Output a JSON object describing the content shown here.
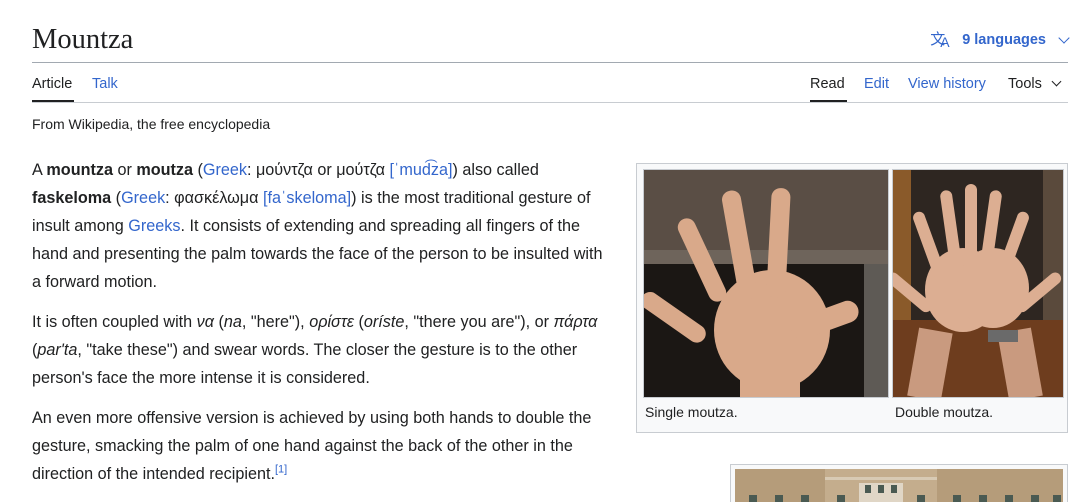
{
  "page": {
    "title": "Mountza",
    "languages_label": "9 languages",
    "tagline": "From Wikipedia, the free encyclopedia"
  },
  "tabs": {
    "left": [
      {
        "label": "Article",
        "active": true
      },
      {
        "label": "Talk",
        "active": false
      }
    ],
    "right": [
      {
        "label": "Read",
        "active": true
      },
      {
        "label": "Edit",
        "active": false
      },
      {
        "label": "View history",
        "active": false
      },
      {
        "label": "Tools",
        "active": false
      }
    ]
  },
  "article": {
    "p1": {
      "t1": "A ",
      "b1": "mountza",
      "t2": " or ",
      "b2": "moutza",
      "t3": " (",
      "link_greek1": "Greek",
      "t4": ": μούντζα or μούτζα ",
      "ipa1": "[ˈmud͡za]",
      "t5": ") also called ",
      "b3": "faskeloma",
      "t6": " (",
      "link_greek2": "Greek",
      "t7": ": φασκέλωμα ",
      "ipa2": "[faˈskeloma]",
      "t8": ") is the most traditional gesture of insult among ",
      "link_greeks": "Greeks",
      "t9": ". It consists of extending and spreading all fingers of the hand and presenting the palm towards the face of the person to be insulted with a forward motion."
    },
    "p2": {
      "t1": "It is often coupled with ",
      "i1": "να",
      "t2": " (",
      "i2": "na",
      "t3": ", \"here\"), ",
      "i3": "ορίστε",
      "t4": " (",
      "i4": "oríste",
      "t5": ", \"there you are\"), or ",
      "i5": "πάρτα",
      "t6": " (",
      "i6": "par'ta",
      "t7": ", \"take these\") and swear words. The closer the gesture is to the other person's face the more intense it is considered."
    },
    "p3": {
      "text": "An even more offensive version is achieved by using both hands to double the gesture, smacking the palm of one hand against the back of the other in the direction of the intended recipient.",
      "ref": "[1]"
    }
  },
  "figure": {
    "captions": [
      "Single moutza.",
      "Double moutza."
    ]
  },
  "icons": {
    "language": "translate-icon",
    "chevron": "chevron-down-icon"
  },
  "colors": {
    "link": "#3366cc",
    "text": "#202122",
    "border": "#c8ccd1",
    "thumb_bg": "#f8f9fa"
  }
}
